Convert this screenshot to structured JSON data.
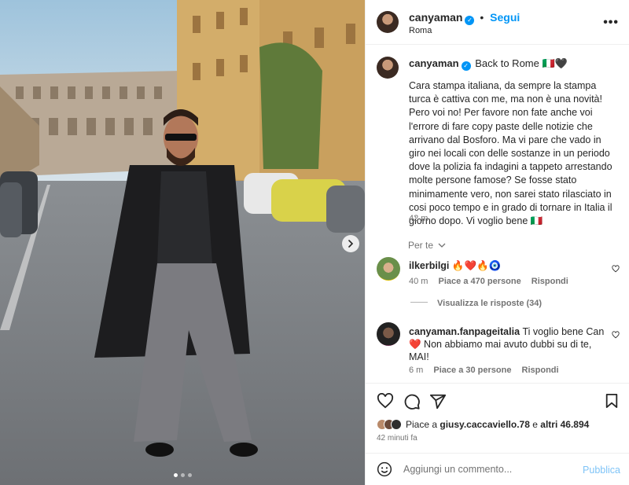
{
  "header": {
    "username": "canyaman",
    "follow_label": "Segui",
    "location": "Roma",
    "more_label": "•••"
  },
  "caption": {
    "username": "canyaman",
    "title": "Back to Rome 🇮🇹🖤",
    "body": "Cara stampa italiana, da sempre la stampa turca è cattiva con me, ma non è una novità! Pero voi no! Per favore non fate anche voi l'errore di fare copy paste delle notizie che arrivano dal Bosforo. Ma vi pare che vado in giro nei locali con delle sostanze in un periodo dove la polizia fa indagini a tappeto arrestando molte persone famose? Se fosse stato minimamente vero, non sarei stato rilasciato in cosi poco tempo e in grado di tornare in Italia il giorno dopo. Vi voglio bene 🇮🇹",
    "time": "42 m"
  },
  "translate_label": "Per te",
  "comments": [
    {
      "username": "ilkerbilgi",
      "text": "🔥❤️🔥🧿",
      "time": "40 m",
      "likes": "Piace a 470 persone",
      "reply": "Rispondi",
      "view_replies": "Visualizza le risposte (34)"
    },
    {
      "username": "canyaman.fanpageitalia",
      "text": "Ti voglio bene Can ❤️ Non abbiamo mai avuto dubbi su di te, MAI!",
      "time": "6 m",
      "likes": "Piace a 30 persone",
      "reply": "Rispondi"
    }
  ],
  "likes": {
    "prefix": "Piace a",
    "user": "giusy.caccaviello.78",
    "middle": "e",
    "others": "altri 46.894"
  },
  "post_time": "42 minuti fa",
  "comment_box": {
    "placeholder": "Aggiungi un commento...",
    "publish_label": "Pubblica"
  },
  "carousel": {
    "slide_count": 3,
    "active_index": 0
  },
  "colors": {
    "accent": "#0095f6",
    "publish_disabled": "#7fc4f7",
    "text": "#262626",
    "muted": "#737373"
  },
  "icons": [
    "verified-badge-icon",
    "more-options-icon",
    "chevron-right-icon",
    "chevron-down-icon",
    "heart-icon",
    "comment-icon",
    "share-icon",
    "bookmark-icon",
    "emoji-icon"
  ]
}
